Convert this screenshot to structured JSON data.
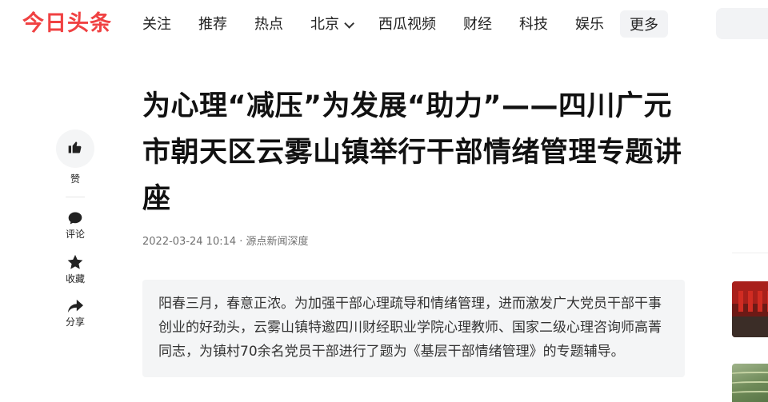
{
  "header": {
    "logo": "今日头条",
    "nav": [
      "关注",
      "推荐",
      "热点",
      "北京",
      "西瓜视频",
      "财经",
      "科技",
      "娱乐"
    ],
    "more_label": "更多"
  },
  "rail": {
    "like_label": "赞",
    "comment_label": "评论",
    "collect_label": "收藏",
    "share_label": "分享"
  },
  "article": {
    "title": "为心理“减压”为发展“助力”——四川广元市朝天区云雾山镇举行干部情绪管理专题讲座",
    "meta": "2022-03-24 10:14 · 源点新闻深度",
    "summary": "阳春三月，春意正浓。为加强干部心理疏导和情绪管理，进而激发广大党员干部干事创业的好劲头，云雾山镇特邀四川财经职业学院心理教师、国家二级心理咨询师高菁同志，为镇村70余名党员干部进行了题为《基层干部情绪管理》的专题辅导。"
  },
  "colors": {
    "brand": "#f04142",
    "summary_bg": "#f4f5f6"
  },
  "icons": {
    "like": "thumbs-up-icon",
    "comment": "comment-icon",
    "collect": "star-icon",
    "share": "share-arrow-icon",
    "dropdown": "chevron-down-icon"
  }
}
